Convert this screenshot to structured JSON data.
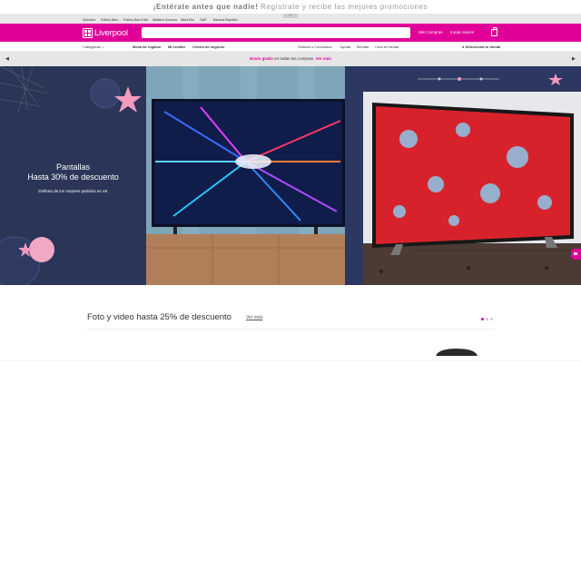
{
  "topbar": {
    "bold": "¡Entérate antes que nadie!",
    "rest": "Regístrate y recibe las mejores promociones"
  },
  "brands": {
    "tabs": [
      "Suburbia",
      "Pottery Barn",
      "Pottery Barn Kids",
      "Williams Sonoma",
      "West Elm",
      "GAP",
      "Banana Republic"
    ],
    "mini_label": "***"
  },
  "header": {
    "logo_text": "Liverpool",
    "search_placeholder": "",
    "my_purchases": "Mis Compras",
    "login": "Iniciar sesión"
  },
  "nav": {
    "categories": "Categorías",
    "items": [
      "Mesa de regalos",
      "Mi crédito",
      "Centro de seguros"
    ],
    "right_items": [
      "Sorteos o Concursos",
      "Ayuda",
      "Tiendas",
      "Crea en tienda"
    ],
    "store_select": "Selecciona tu tienda"
  },
  "promo": {
    "pink": "Envío gratis",
    "text": "en todas tus compras.",
    "link": "Ver más"
  },
  "hero": {
    "title_line1": "Pantallas",
    "title_line2": "Hasta 30% de descuento",
    "subtitle": "Disfruta de los mejores partidos en 4K"
  },
  "section": {
    "title": "Foto y video hasta 25% de descuento",
    "link": "Ver más"
  },
  "colors": {
    "brand": "#e10098",
    "nav_dark": "#2a3557"
  }
}
